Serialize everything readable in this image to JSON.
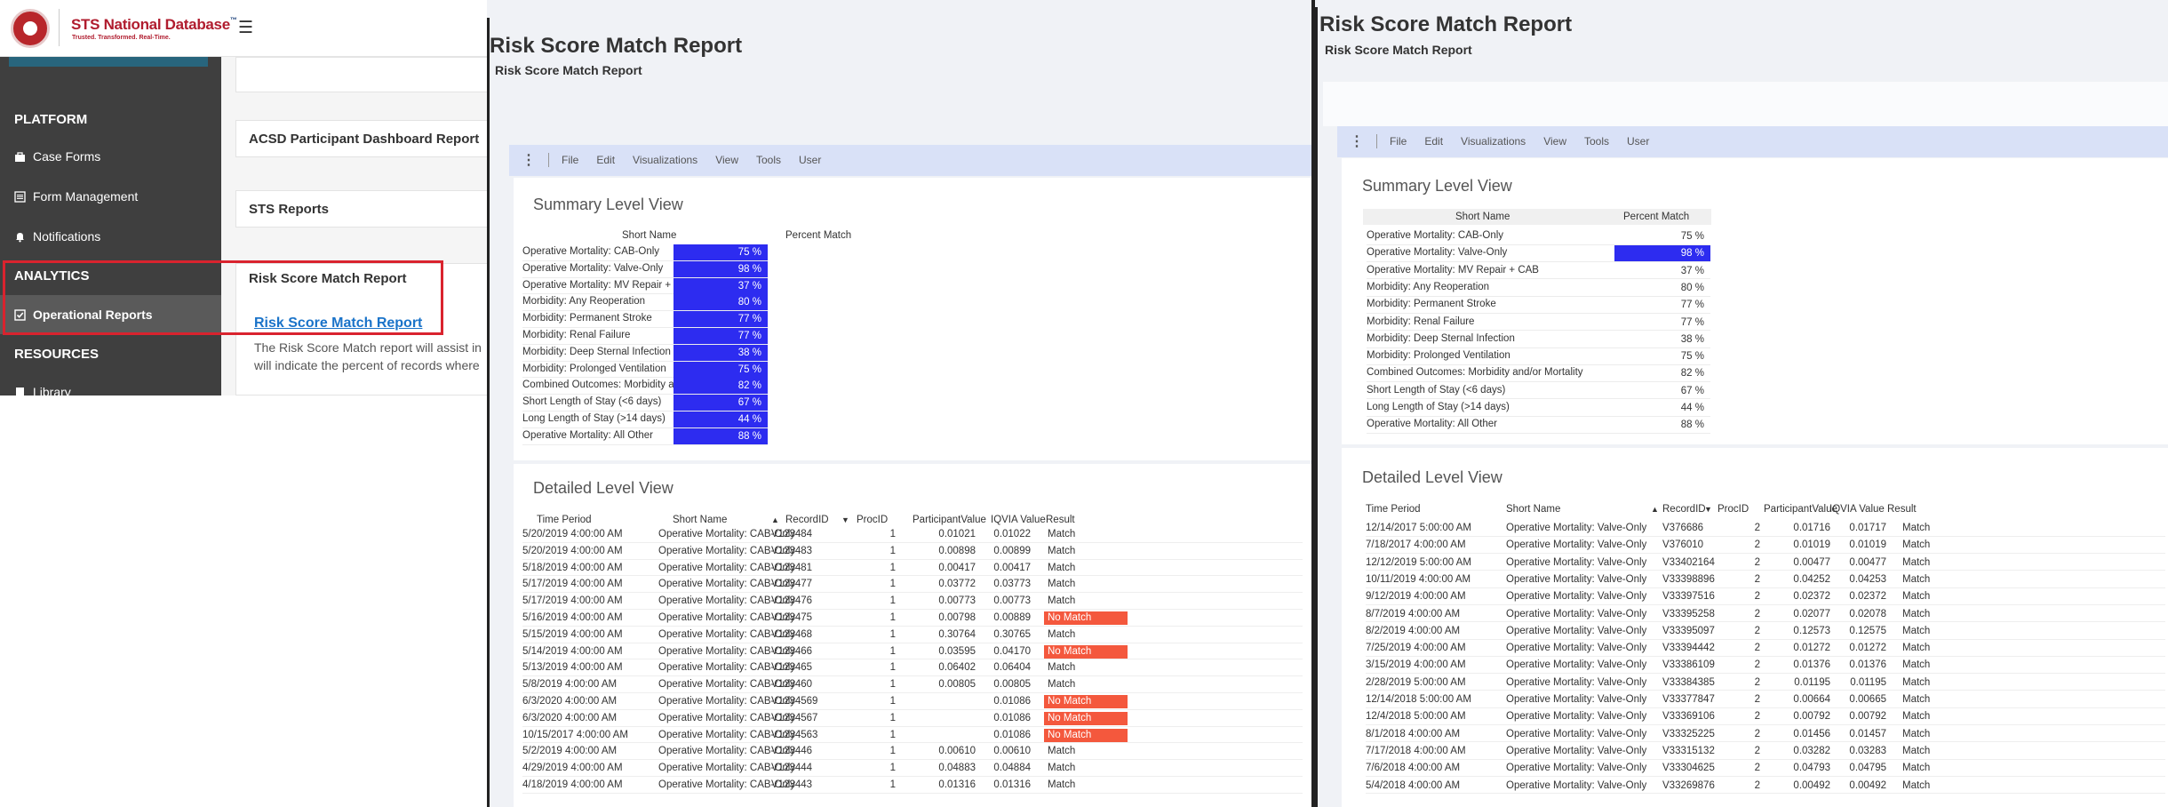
{
  "portal": {
    "brand": "STS National Database",
    "brand_tm": "™",
    "tagline": "Trusted. Transformed. Real-Time.",
    "menu_icon": "hamburger-icon",
    "sidebar": {
      "platform_header": "PLATFORM",
      "items_platform": [
        {
          "label": "Case Forms",
          "icon": "briefcase-icon"
        },
        {
          "label": "Form Management",
          "icon": "list-icon"
        },
        {
          "label": "Notifications",
          "icon": "bell-icon"
        }
      ],
      "analytics_header": "ANALYTICS",
      "operational_reports": {
        "label": "Operational Reports",
        "icon": "check-square-icon"
      },
      "resources_header": "RESOURCES",
      "library": {
        "label": "Library",
        "icon": "book-icon"
      }
    },
    "cards": {
      "acsd": "ACSD Participant Dashboard Report",
      "sts_reports": "STS Reports",
      "risk_score": "Risk Score Match Report"
    },
    "link": "Risk Score Match Report",
    "description_line1": "The Risk Score Match report will assist in",
    "description_line2": "will indicate the percent of records where"
  },
  "toolbar": {
    "items": [
      "File",
      "Edit",
      "Visualizations",
      "View",
      "Tools",
      "User"
    ]
  },
  "report_left": {
    "title": "Risk Score Match Report",
    "subtitle": "Risk Score Match Report",
    "summary_title": "Summary Level View",
    "summary_headers": {
      "name": "Short Name",
      "pct": "Percent Match"
    },
    "summary_rows": [
      {
        "name": "Operative Mortality: CAB-Only",
        "pct": "75 %",
        "value": 75,
        "highlight": true
      },
      {
        "name": "Operative Mortality: Valve-Only",
        "pct": "98 %",
        "value": 98,
        "highlight": true
      },
      {
        "name": "Operative Mortality: MV Repair + CAB",
        "pct": "37 %",
        "value": 37,
        "highlight": true
      },
      {
        "name": "Morbidity: Any Reoperation",
        "pct": "80 %",
        "value": 80,
        "highlight": true
      },
      {
        "name": "Morbidity: Permanent Stroke",
        "pct": "77 %",
        "value": 77,
        "highlight": true
      },
      {
        "name": "Morbidity: Renal Failure",
        "pct": "77 %",
        "value": 77,
        "highlight": true
      },
      {
        "name": "Morbidity: Deep Sternal Infection",
        "pct": "38 %",
        "value": 38,
        "highlight": true
      },
      {
        "name": "Morbidity: Prolonged Ventilation",
        "pct": "75 %",
        "value": 75,
        "highlight": true
      },
      {
        "name": "Combined Outcomes: Morbidity and/or Mortality",
        "pct": "82 %",
        "value": 82,
        "highlight": true
      },
      {
        "name": "Short Length of Stay (<6 days)",
        "pct": "67 %",
        "value": 67,
        "highlight": true
      },
      {
        "name": "Long Length of Stay (>14 days)",
        "pct": "44 %",
        "value": 44,
        "highlight": true
      },
      {
        "name": "Operative Mortality: All Other",
        "pct": "88 %",
        "value": 88,
        "highlight": true
      }
    ],
    "detail_title": "Detailed Level View",
    "detail_headers": {
      "time": "Time Period",
      "name": "Short Name",
      "record": "RecordID",
      "proc": "ProcID",
      "participant": "ParticipantValue",
      "iqvia": "IQVIA Value",
      "result": "Result"
    },
    "detail_rows": [
      {
        "time": "5/20/2019 4:00:00 AM",
        "name": "Operative Mortality: CAB-Only",
        "record": "V123484",
        "proc": "1",
        "participant": "0.01021",
        "iqvia": "0.01022",
        "result": "Match"
      },
      {
        "time": "5/20/2019 4:00:00 AM",
        "name": "Operative Mortality: CAB-Only",
        "record": "V123483",
        "proc": "1",
        "participant": "0.00898",
        "iqvia": "0.00899",
        "result": "Match"
      },
      {
        "time": "5/18/2019 4:00:00 AM",
        "name": "Operative Mortality: CAB-Only",
        "record": "V123481",
        "proc": "1",
        "participant": "0.00417",
        "iqvia": "0.00417",
        "result": "Match"
      },
      {
        "time": "5/17/2019 4:00:00 AM",
        "name": "Operative Mortality: CAB-Only",
        "record": "V123477",
        "proc": "1",
        "participant": "0.03772",
        "iqvia": "0.03773",
        "result": "Match"
      },
      {
        "time": "5/17/2019 4:00:00 AM",
        "name": "Operative Mortality: CAB-Only",
        "record": "V123476",
        "proc": "1",
        "participant": "0.00773",
        "iqvia": "0.00773",
        "result": "Match"
      },
      {
        "time": "5/16/2019 4:00:00 AM",
        "name": "Operative Mortality: CAB-Only",
        "record": "V123475",
        "proc": "1",
        "participant": "0.00798",
        "iqvia": "0.00889",
        "result": "No Match"
      },
      {
        "time": "5/15/2019 4:00:00 AM",
        "name": "Operative Mortality: CAB-Only",
        "record": "V123468",
        "proc": "1",
        "participant": "0.30764",
        "iqvia": "0.30765",
        "result": "Match"
      },
      {
        "time": "5/14/2019 4:00:00 AM",
        "name": "Operative Mortality: CAB-Only",
        "record": "V123466",
        "proc": "1",
        "participant": "0.03595",
        "iqvia": "0.04170",
        "result": "No Match"
      },
      {
        "time": "5/13/2019 4:00:00 AM",
        "name": "Operative Mortality: CAB-Only",
        "record": "V123465",
        "proc": "1",
        "participant": "0.06402",
        "iqvia": "0.06404",
        "result": "Match"
      },
      {
        "time": "5/8/2019 4:00:00 AM",
        "name": "Operative Mortality: CAB-Only",
        "record": "V123460",
        "proc": "1",
        "participant": "0.00805",
        "iqvia": "0.00805",
        "result": "Match"
      },
      {
        "time": "6/3/2020 4:00:00 AM",
        "name": "Operative Mortality: CAB-Only",
        "record": "V1234569",
        "proc": "1",
        "participant": "",
        "iqvia": "0.01086",
        "result": "No Match"
      },
      {
        "time": "6/3/2020 4:00:00 AM",
        "name": "Operative Mortality: CAB-Only",
        "record": "V1234567",
        "proc": "1",
        "participant": "",
        "iqvia": "0.01086",
        "result": "No Match"
      },
      {
        "time": "10/15/2017 4:00:00 AM",
        "name": "Operative Mortality: CAB-Only",
        "record": "V1234563",
        "proc": "1",
        "participant": "",
        "iqvia": "0.01086",
        "result": "No Match"
      },
      {
        "time": "5/2/2019 4:00:00 AM",
        "name": "Operative Mortality: CAB-Only",
        "record": "V123446",
        "proc": "1",
        "participant": "0.00610",
        "iqvia": "0.00610",
        "result": "Match"
      },
      {
        "time": "4/29/2019 4:00:00 AM",
        "name": "Operative Mortality: CAB-Only",
        "record": "V123444",
        "proc": "1",
        "participant": "0.04883",
        "iqvia": "0.04884",
        "result": "Match"
      },
      {
        "time": "4/18/2019 4:00:00 AM",
        "name": "Operative Mortality: CAB-Only",
        "record": "V123443",
        "proc": "1",
        "participant": "0.01316",
        "iqvia": "0.01316",
        "result": "Match"
      }
    ]
  },
  "report_right": {
    "title": "Risk Score Match Report",
    "subtitle": "Risk Score Match Report",
    "summary_title": "Summary Level View",
    "summary_headers": {
      "name": "Short Name",
      "pct": "Percent Match"
    },
    "summary_rows": [
      {
        "name": "Operative Mortality: CAB-Only",
        "pct": "75 %",
        "value": 75,
        "highlight": false
      },
      {
        "name": "Operative Mortality: Valve-Only",
        "pct": "98 %",
        "value": 98,
        "highlight": true
      },
      {
        "name": "Operative Mortality: MV Repair + CAB",
        "pct": "37 %",
        "value": 37,
        "highlight": false
      },
      {
        "name": "Morbidity: Any Reoperation",
        "pct": "80 %",
        "value": 80,
        "highlight": false
      },
      {
        "name": "Morbidity: Permanent Stroke",
        "pct": "77 %",
        "value": 77,
        "highlight": false
      },
      {
        "name": "Morbidity: Renal Failure",
        "pct": "77 %",
        "value": 77,
        "highlight": false
      },
      {
        "name": "Morbidity: Deep Sternal Infection",
        "pct": "38 %",
        "value": 38,
        "highlight": false
      },
      {
        "name": "Morbidity: Prolonged Ventilation",
        "pct": "75 %",
        "value": 75,
        "highlight": false
      },
      {
        "name": "Combined Outcomes: Morbidity and/or Mortality",
        "pct": "82 %",
        "value": 82,
        "highlight": false
      },
      {
        "name": "Short Length of Stay (<6 days)",
        "pct": "67 %",
        "value": 67,
        "highlight": false
      },
      {
        "name": "Long Length of Stay (>14 days)",
        "pct": "44 %",
        "value": 44,
        "highlight": false
      },
      {
        "name": "Operative Mortality: All Other",
        "pct": "88 %",
        "value": 88,
        "highlight": false
      }
    ],
    "detail_title": "Detailed Level View",
    "detail_headers": {
      "time": "Time Period",
      "name": "Short Name",
      "record": "RecordID",
      "proc": "ProcID",
      "participant": "ParticipantValue",
      "iqvia": "IQVIA Value",
      "result": "Result"
    },
    "detail_rows": [
      {
        "time": "12/14/2017 5:00:00 AM",
        "name": "Operative Mortality: Valve-Only",
        "record": "V376686",
        "proc": "2",
        "participant": "0.01716",
        "iqvia": "0.01717",
        "result": "Match"
      },
      {
        "time": "7/18/2017 4:00:00 AM",
        "name": "Operative Mortality: Valve-Only",
        "record": "V376010",
        "proc": "2",
        "participant": "0.01019",
        "iqvia": "0.01019",
        "result": "Match"
      },
      {
        "time": "12/12/2019 5:00:00 AM",
        "name": "Operative Mortality: Valve-Only",
        "record": "V33402164",
        "proc": "2",
        "participant": "0.00477",
        "iqvia": "0.00477",
        "result": "Match"
      },
      {
        "time": "10/11/2019 4:00:00 AM",
        "name": "Operative Mortality: Valve-Only",
        "record": "V33398896",
        "proc": "2",
        "participant": "0.04252",
        "iqvia": "0.04253",
        "result": "Match"
      },
      {
        "time": "9/12/2019 4:00:00 AM",
        "name": "Operative Mortality: Valve-Only",
        "record": "V33397516",
        "proc": "2",
        "participant": "0.02372",
        "iqvia": "0.02372",
        "result": "Match"
      },
      {
        "time": "8/7/2019 4:00:00 AM",
        "name": "Operative Mortality: Valve-Only",
        "record": "V33395258",
        "proc": "2",
        "participant": "0.02077",
        "iqvia": "0.02078",
        "result": "Match"
      },
      {
        "time": "8/2/2019 4:00:00 AM",
        "name": "Operative Mortality: Valve-Only",
        "record": "V33395097",
        "proc": "2",
        "participant": "0.12573",
        "iqvia": "0.12575",
        "result": "Match"
      },
      {
        "time": "7/25/2019 4:00:00 AM",
        "name": "Operative Mortality: Valve-Only",
        "record": "V33394442",
        "proc": "2",
        "participant": "0.01272",
        "iqvia": "0.01272",
        "result": "Match"
      },
      {
        "time": "3/15/2019 4:00:00 AM",
        "name": "Operative Mortality: Valve-Only",
        "record": "V33386109",
        "proc": "2",
        "participant": "0.01376",
        "iqvia": "0.01376",
        "result": "Match"
      },
      {
        "time": "2/28/2019 5:00:00 AM",
        "name": "Operative Mortality: Valve-Only",
        "record": "V33384385",
        "proc": "2",
        "participant": "0.01195",
        "iqvia": "0.01195",
        "result": "Match"
      },
      {
        "time": "12/14/2018 5:00:00 AM",
        "name": "Operative Mortality: Valve-Only",
        "record": "V33377847",
        "proc": "2",
        "participant": "0.00664",
        "iqvia": "0.00665",
        "result": "Match"
      },
      {
        "time": "12/4/2018 5:00:00 AM",
        "name": "Operative Mortality: Valve-Only",
        "record": "V33369106",
        "proc": "2",
        "participant": "0.00792",
        "iqvia": "0.00792",
        "result": "Match"
      },
      {
        "time": "8/1/2018 4:00:00 AM",
        "name": "Operative Mortality: Valve-Only",
        "record": "V33325225",
        "proc": "2",
        "participant": "0.01456",
        "iqvia": "0.01457",
        "result": "Match"
      },
      {
        "time": "7/17/2018 4:00:00 AM",
        "name": "Operative Mortality: Valve-Only",
        "record": "V33315132",
        "proc": "2",
        "participant": "0.03282",
        "iqvia": "0.03283",
        "result": "Match"
      },
      {
        "time": "7/6/2018 4:00:00 AM",
        "name": "Operative Mortality: Valve-Only",
        "record": "V33304625",
        "proc": "2",
        "participant": "0.04793",
        "iqvia": "0.04795",
        "result": "Match"
      },
      {
        "time": "5/4/2018 4:00:00 AM",
        "name": "Operative Mortality: Valve-Only",
        "record": "V33269876",
        "proc": "2",
        "participant": "0.00492",
        "iqvia": "0.00492",
        "result": "Match"
      }
    ]
  },
  "colors": {
    "highlight": "#2d2cf0",
    "no_match": "#f4583d",
    "brand_red": "#b01c2e",
    "sidebar_bg": "#3f3f3f",
    "callout": "#d9232e",
    "link": "#1a73c9"
  }
}
